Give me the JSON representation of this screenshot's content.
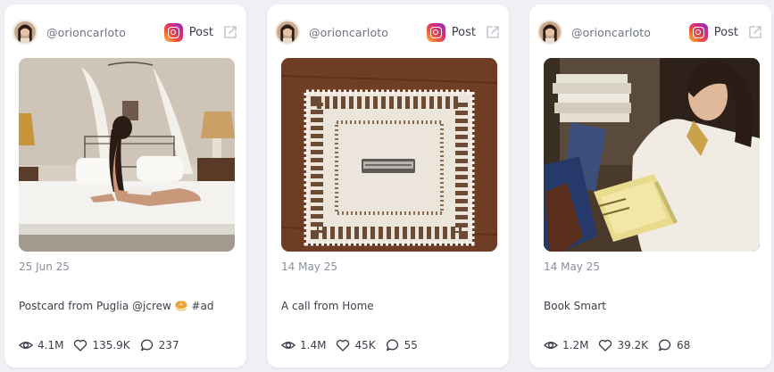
{
  "colors": {
    "page_background": "#eef0f5",
    "card_background": "#ffffff",
    "text_primary": "#3b3f4a",
    "text_muted": "#8a8f9c"
  },
  "cards": [
    {
      "handle": "@orioncarloto",
      "platform_icon": "instagram-icon",
      "post_label": "Post",
      "date": "25 Jun 25",
      "caption": "Postcard from Puglia @jcrew 🥯 #ad",
      "views": "4.1M",
      "likes": "135.9K",
      "comments": "237"
    },
    {
      "handle": "@orioncarloto",
      "platform_icon": "instagram-icon",
      "post_label": "Post",
      "date": "14 May 25",
      "caption": "A call from Home",
      "views": "1.4M",
      "likes": "45K",
      "comments": "55"
    },
    {
      "handle": "@orioncarloto",
      "platform_icon": "instagram-icon",
      "post_label": "Post",
      "date": "14 May 25",
      "caption": "Book Smart",
      "views": "1.2M",
      "likes": "39.2K",
      "comments": "68"
    }
  ]
}
